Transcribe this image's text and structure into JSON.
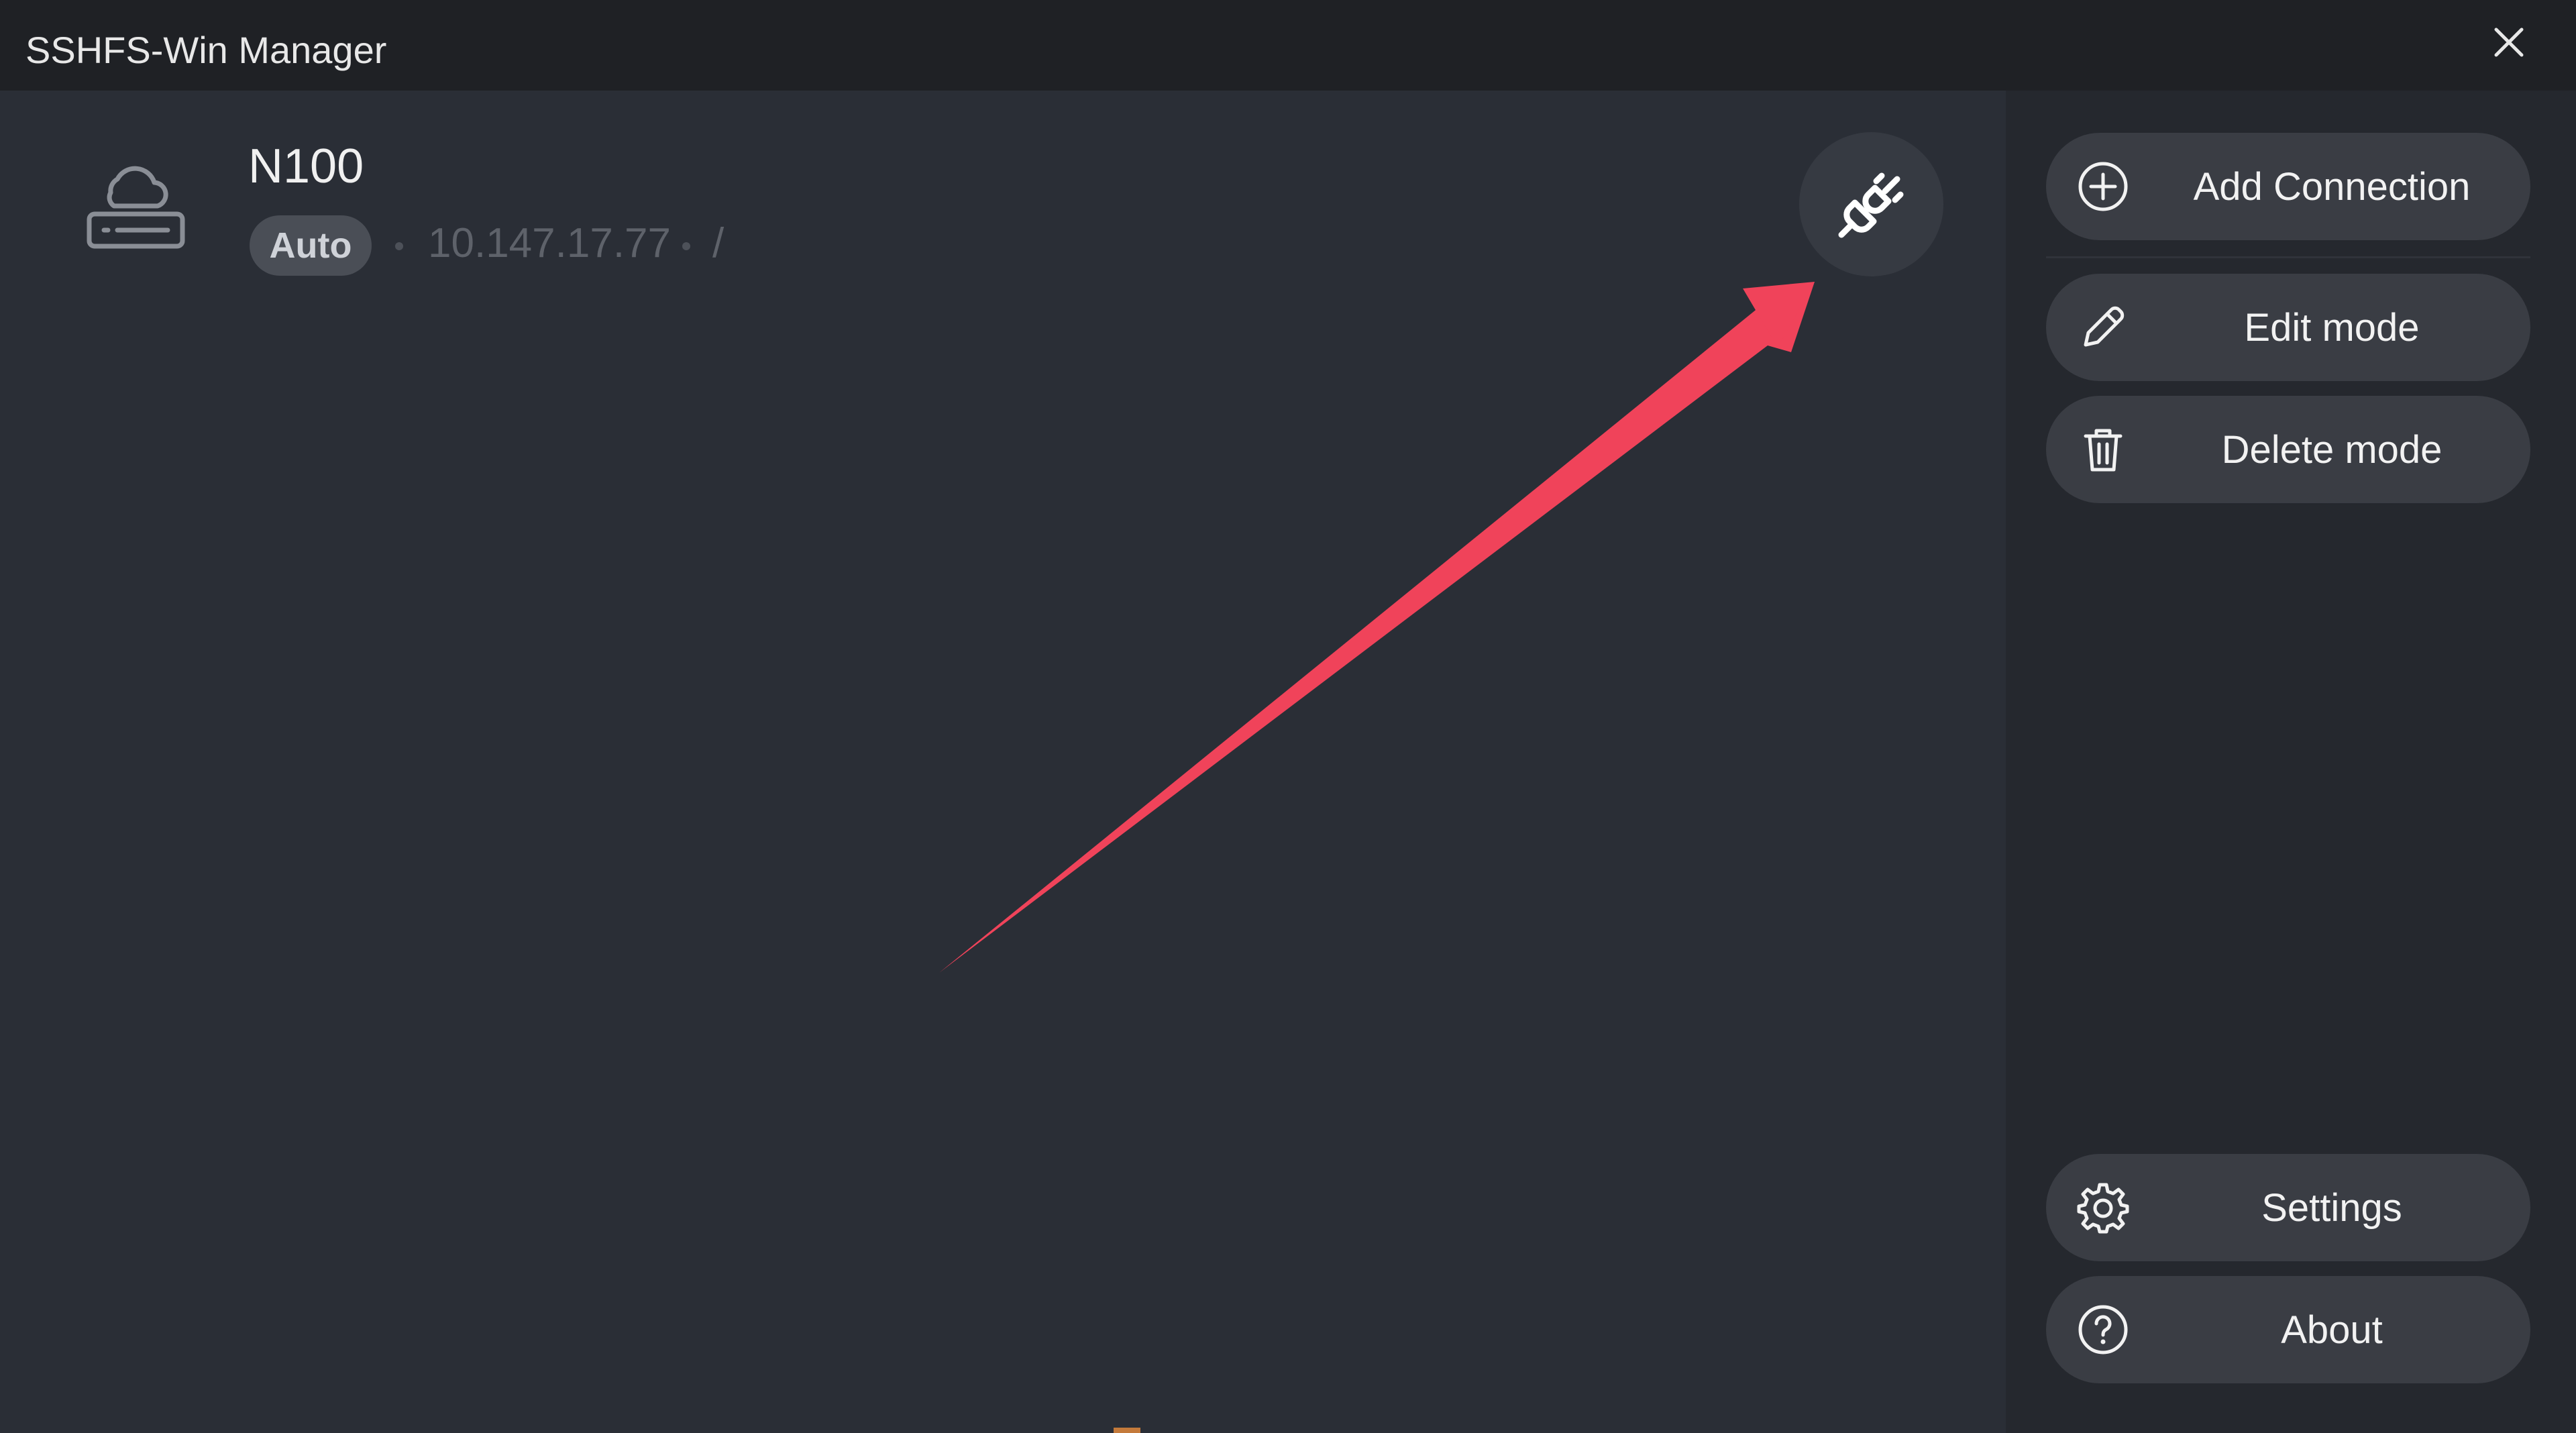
{
  "window": {
    "title": "SSHFS-Win Manager",
    "close_icon": "close-icon"
  },
  "connection": {
    "name": "N100",
    "badge": "Auto",
    "host": "10.147.17.77",
    "path": "/",
    "icon": "server-cloud-icon",
    "action_icon": "plug-disconnected-icon"
  },
  "annotation": {
    "type": "arrow",
    "color": "#f0435a"
  },
  "sidebar": {
    "top_buttons": [
      {
        "label": "Add Connection",
        "icon": "add-circle-icon"
      },
      {
        "label": "Edit mode",
        "icon": "pencil-icon"
      },
      {
        "label": "Delete mode",
        "icon": "trash-icon"
      }
    ],
    "bottom_buttons": [
      {
        "label": "Settings",
        "icon": "gear-icon"
      },
      {
        "label": "About",
        "icon": "help-circle-icon"
      }
    ]
  },
  "colors": {
    "background": "#2a2e36",
    "sidebar": "#25282e",
    "titlebar": "#1f2125",
    "button": "#3a3d44",
    "text": "#f2f2f2",
    "muted_text": "#5e626a",
    "arrow": "#f0435a"
  }
}
